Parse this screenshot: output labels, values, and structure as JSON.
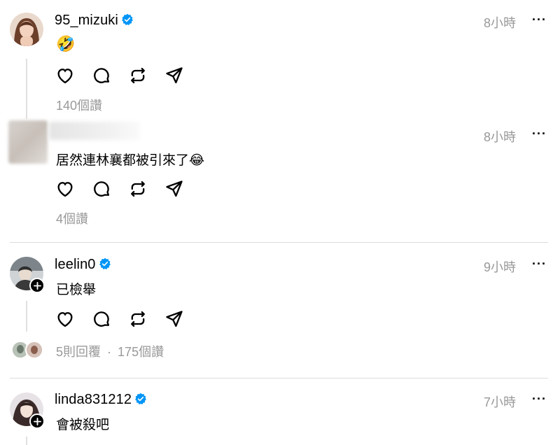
{
  "posts": [
    {
      "username": "95_mizuki",
      "verified": true,
      "time": "8小時",
      "more": "···",
      "text": "🤣",
      "likes": "140個讚"
    },
    {
      "username": "",
      "verified": false,
      "time": "8小時",
      "more": "···",
      "text": "居然連林襄都被引來了😂",
      "likes": "4個讚"
    },
    {
      "username": "leelin0",
      "verified": true,
      "time": "9小時",
      "more": "···",
      "text": "已檢舉",
      "replies": "5則回覆",
      "separator": "·",
      "likes": "175個讚"
    },
    {
      "username": "linda831212",
      "verified": true,
      "time": "7小時",
      "more": "···",
      "text": "會被殺吧"
    }
  ],
  "icons": {
    "like": "heart-icon",
    "comment": "comment-icon",
    "repost": "repost-icon",
    "share": "share-icon",
    "verified": "verified-badge-icon",
    "follow": "plus-icon"
  },
  "colors": {
    "verified": "#0095f6",
    "muted": "#999999",
    "divider": "#dcdcdc"
  }
}
